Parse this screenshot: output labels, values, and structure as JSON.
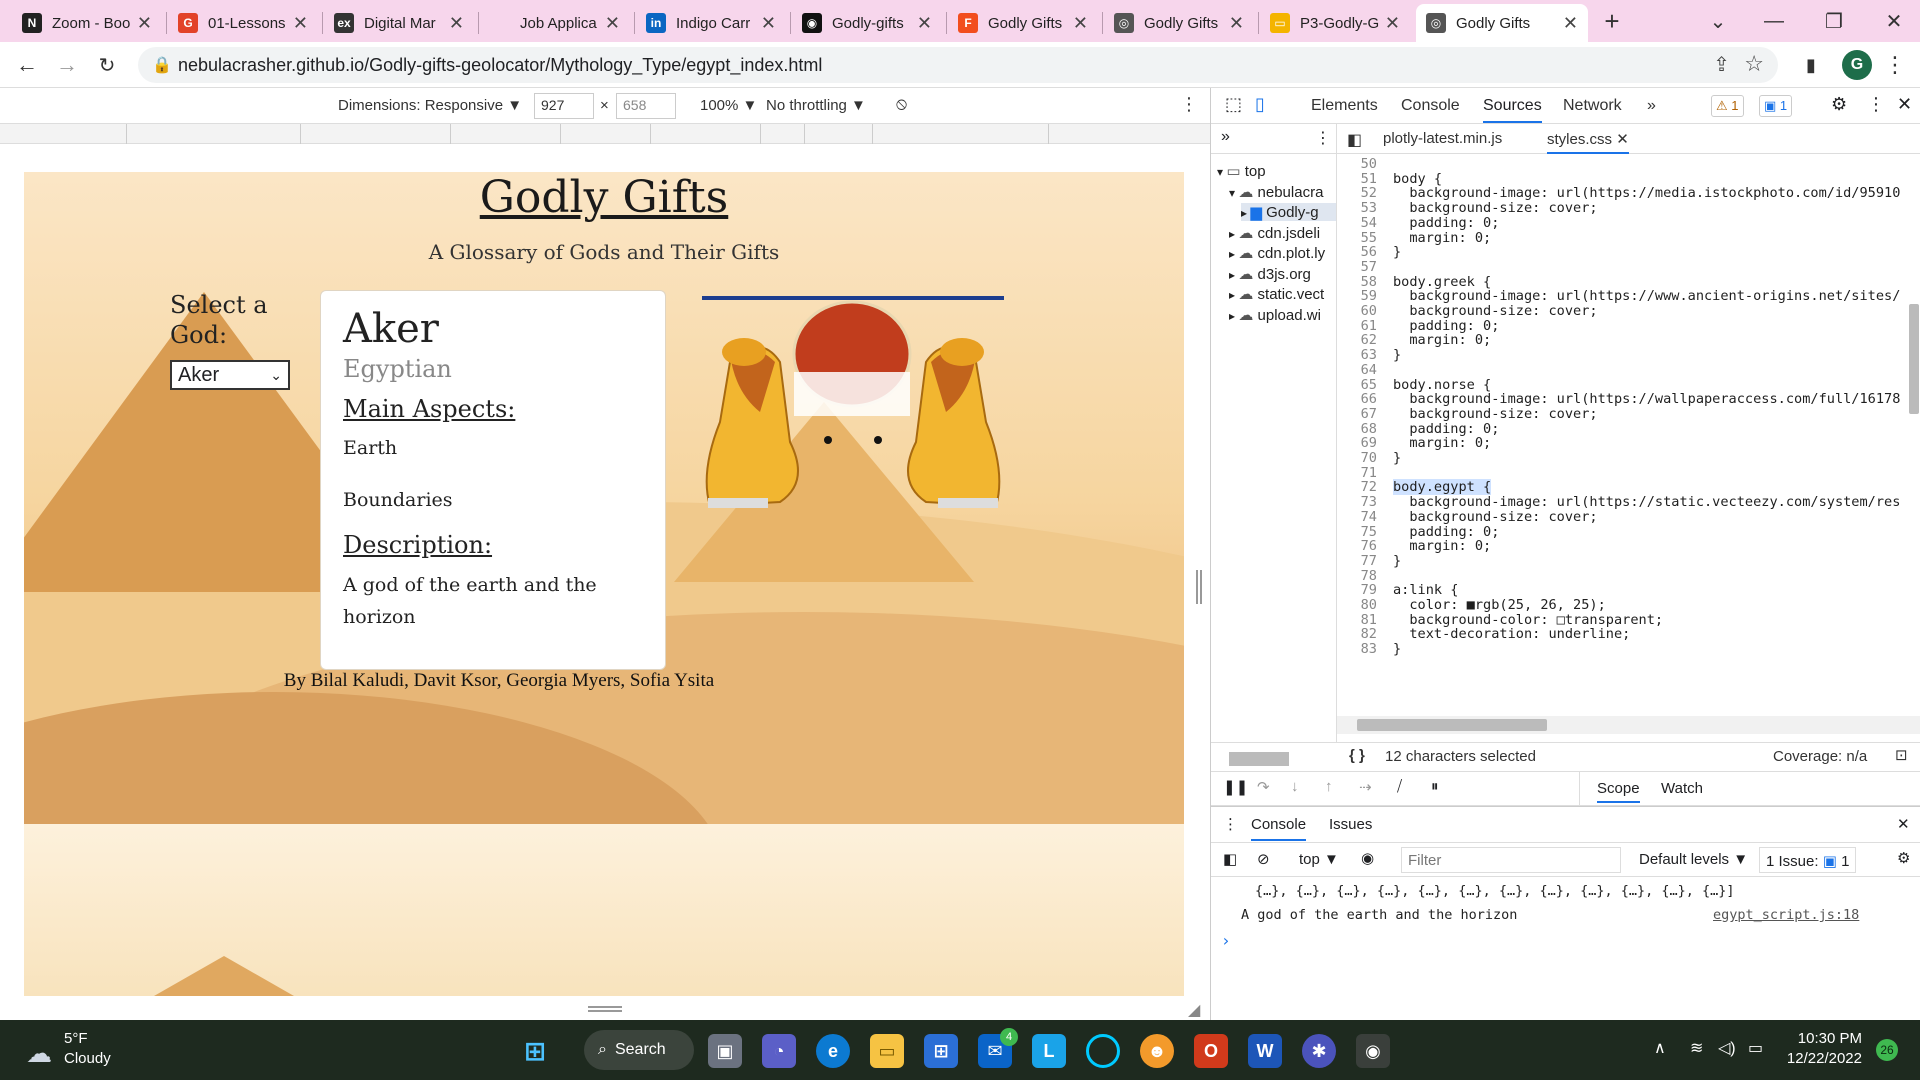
{
  "browser": {
    "tabs": [
      {
        "title": "Zoom - Boo",
        "icon": "notion-icon",
        "color": "#222222",
        "glyph": "N"
      },
      {
        "title": "01-Lessons",
        "icon": "gitlab-icon",
        "color": "#e24329",
        "glyph": "G"
      },
      {
        "title": "Digital Mar",
        "icon": "edx-icon",
        "color": "#333333",
        "glyph": "ex"
      },
      {
        "title": "Job Applica",
        "icon": "blank-page-icon",
        "color": "#f7d6ec",
        "glyph": ""
      },
      {
        "title": "Indigo Carr",
        "icon": "linkedin-icon",
        "color": "#0a66c2",
        "glyph": "in"
      },
      {
        "title": "Godly-gifts",
        "icon": "github-icon",
        "color": "#111111",
        "glyph": "◉"
      },
      {
        "title": "Godly Gifts",
        "icon": "figma-icon",
        "color": "#f24e1e",
        "glyph": "F"
      },
      {
        "title": "Godly Gifts",
        "icon": "globe-icon",
        "color": "#555555",
        "glyph": "◎"
      },
      {
        "title": "P3-Godly-G",
        "icon": "slides-icon",
        "color": "#f4b400",
        "glyph": "▭"
      },
      {
        "title": "Godly Gifts",
        "icon": "globe-icon",
        "color": "#555555",
        "glyph": "◎"
      }
    ],
    "url": "nebulacrasher.github.io/Godly-gifts-geolocator/Mythology_Type/egypt_index.html",
    "profile_initial": "G"
  },
  "device_toolbar": {
    "dimensions_label": "Dimensions: Responsive ▼",
    "width": "927",
    "height": "658",
    "times": "×",
    "zoom": "100% ▼",
    "throttling": "No throttling ▼"
  },
  "site": {
    "title": "Godly Gifts",
    "subtitle": "A Glossary of Gods and Their Gifts",
    "select_label": "Select a God:",
    "selected_god": "Aker",
    "card": {
      "name": "Aker",
      "culture": "Egyptian",
      "aspects_heading": "Main Aspects:",
      "aspect_1": "Earth",
      "aspect_2": "Boundaries",
      "description_heading": "Description:",
      "description": "A god of the earth and the horizon"
    },
    "authors": "By Bilal Kaludi, Davit Ksor, Georgia Myers, Sofia Ysita"
  },
  "devtools": {
    "tabs": [
      "Elements",
      "Console",
      "Sources",
      "Network",
      "»"
    ],
    "active_tab": "Sources",
    "warnings": "1",
    "messages": "1",
    "navigator": [
      {
        "label": "top",
        "indent": 0
      },
      {
        "label": "nebulacra",
        "indent": 1
      },
      {
        "label": "Godly-g",
        "indent": 2
      },
      {
        "label": "cdn.jsdeli",
        "indent": 1
      },
      {
        "label": "cdn.plot.ly",
        "indent": 1
      },
      {
        "label": "d3js.org",
        "indent": 1
      },
      {
        "label": "static.vect",
        "indent": 1
      },
      {
        "label": "upload.wi",
        "indent": 1
      }
    ],
    "files": [
      "plotly-latest.min.js",
      "styles.css"
    ],
    "active_file": "styles.css",
    "code": [
      {
        "n": "50",
        "t": ""
      },
      {
        "n": "51",
        "t": "body {"
      },
      {
        "n": "52",
        "t": "  background-image: url(https://media.istockphoto.com/id/95910"
      },
      {
        "n": "53",
        "t": "  background-size: cover;"
      },
      {
        "n": "54",
        "t": "  padding: 0;"
      },
      {
        "n": "55",
        "t": "  margin: 0;"
      },
      {
        "n": "56",
        "t": "}"
      },
      {
        "n": "57",
        "t": ""
      },
      {
        "n": "58",
        "t": "body.greek {"
      },
      {
        "n": "59",
        "t": "  background-image: url(https://www.ancient-origins.net/sites/"
      },
      {
        "n": "60",
        "t": "  background-size: cover;"
      },
      {
        "n": "61",
        "t": "  padding: 0;"
      },
      {
        "n": "62",
        "t": "  margin: 0;"
      },
      {
        "n": "63",
        "t": "}"
      },
      {
        "n": "64",
        "t": ""
      },
      {
        "n": "65",
        "t": "body.norse {"
      },
      {
        "n": "66",
        "t": "  background-image: url(https://wallpaperaccess.com/full/16178"
      },
      {
        "n": "67",
        "t": "  background-size: cover;"
      },
      {
        "n": "68",
        "t": "  padding: 0;"
      },
      {
        "n": "69",
        "t": "  margin: 0;"
      },
      {
        "n": "70",
        "t": "}"
      },
      {
        "n": "71",
        "t": ""
      },
      {
        "n": "72",
        "t": "body.egypt {"
      },
      {
        "n": "73",
        "t": "  background-image: url(https://static.vecteezy.com/system/res"
      },
      {
        "n": "74",
        "t": "  background-size: cover;"
      },
      {
        "n": "75",
        "t": "  padding: 0;"
      },
      {
        "n": "76",
        "t": "  margin: 0;"
      },
      {
        "n": "77",
        "t": "}"
      },
      {
        "n": "78",
        "t": ""
      },
      {
        "n": "79",
        "t": "a:link {"
      },
      {
        "n": "80",
        "t": "  color: ■rgb(25, 26, 25);"
      },
      {
        "n": "81",
        "t": "  background-color: □transparent;"
      },
      {
        "n": "82",
        "t": "  text-decoration: underline;"
      },
      {
        "n": "83",
        "t": "}"
      }
    ],
    "status": "12 characters selected",
    "coverage": "Coverage: n/a",
    "debug_tabs": [
      "Scope",
      "Watch"
    ],
    "drawer_tabs": [
      "Console",
      "Issues"
    ],
    "console_context": "top ▼",
    "filter_placeholder": "Filter",
    "levels": "Default levels ▼",
    "issues": "1 Issue:",
    "issues_count": "1",
    "console_line_1": "{…}, {…}, {…}, {…}, {…}, {…}, {…}, {…}, {…}, {…}, {…}, {…}]",
    "console_line_2": "A god of the earth and the horizon",
    "console_source": "egypt_script.js:18",
    "prompt": "›"
  },
  "taskbar": {
    "weather_temp": "5°F",
    "weather_desc": "Cloudy",
    "search_label": "Search",
    "time": "10:30 PM",
    "date": "12/22/2022",
    "notif_count": "26",
    "mail_badge": "4"
  }
}
